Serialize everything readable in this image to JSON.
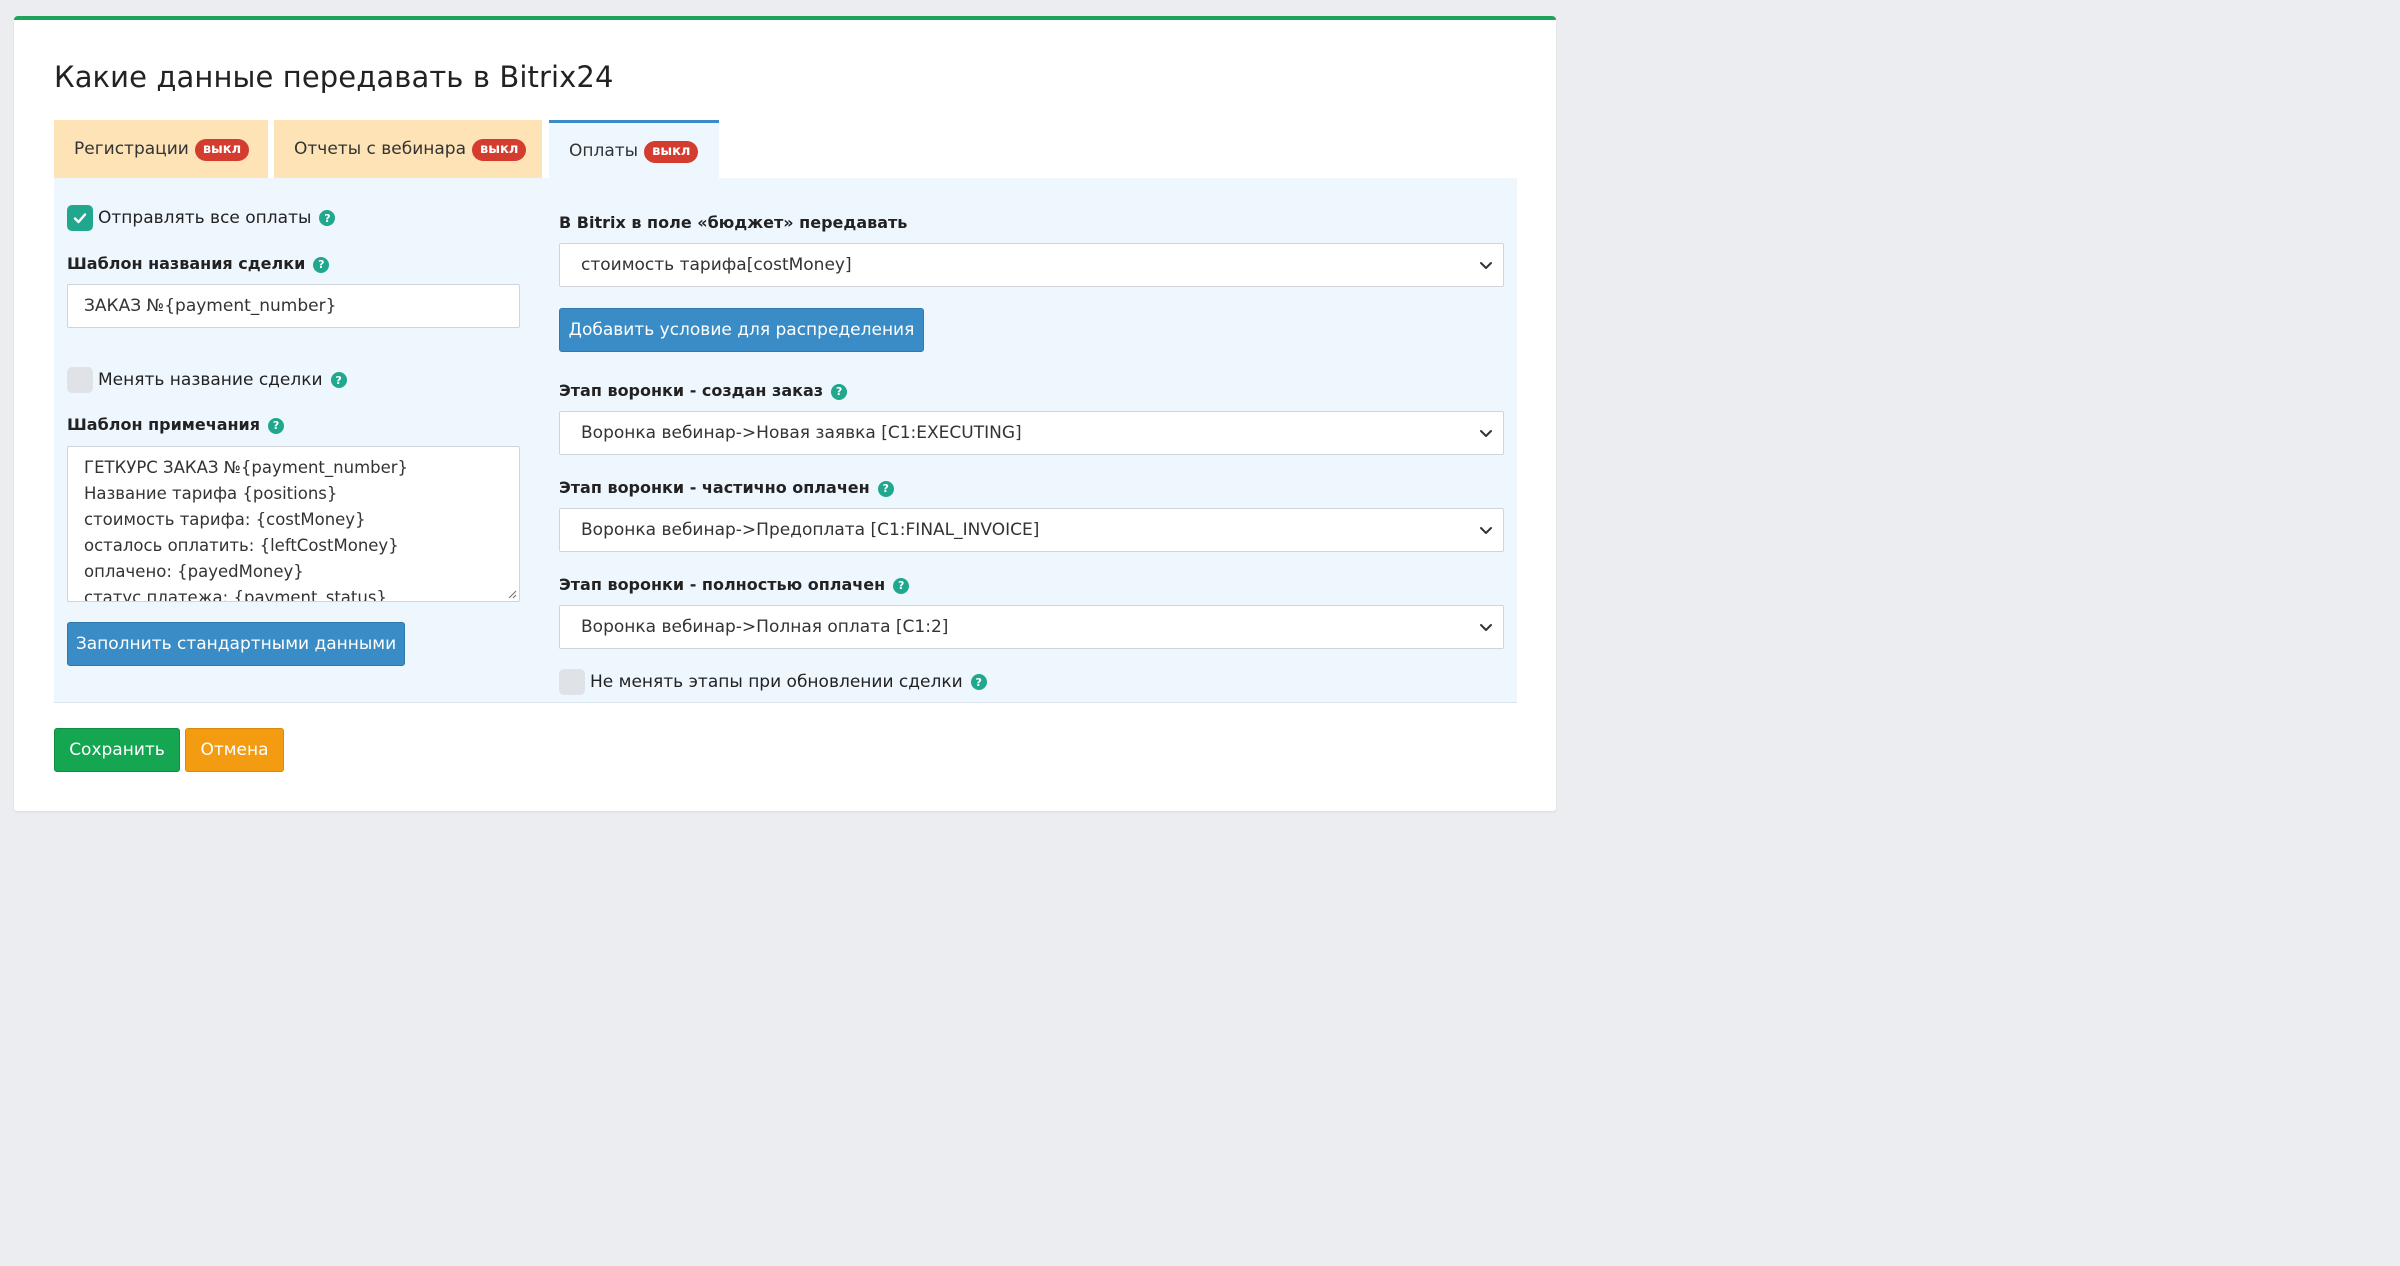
{
  "title": "Какие данные передавать в Bitrix24",
  "colors": {
    "accent_green": "#1ea35a",
    "tab_inactive": "#fde3b6",
    "badge_red": "#d33c2f",
    "primary_blue": "#3a8cc6"
  },
  "tabs": [
    {
      "label": "Регистрации",
      "badge": "выкл",
      "active": false
    },
    {
      "label": "Отчеты с вебинара",
      "badge": "выкл",
      "active": false
    },
    {
      "label": "Оплаты",
      "badge": "выкл",
      "active": true
    }
  ],
  "left": {
    "send_all": {
      "label": "Отправлять все оплаты",
      "checked": true
    },
    "deal_name_template": {
      "label": "Шаблон названия сделки",
      "value": "ЗАКАЗ №{payment_number}"
    },
    "change_deal_name": {
      "label": "Менять название сделки",
      "checked": false
    },
    "note_template": {
      "label": "Шаблон примечания",
      "lines": [
        "ГЕТКУРС ЗАКАЗ №{payment_number}",
        "Название тарифа {positions}",
        "стоимость тарифа: {costMoney}",
        "осталось оплатить: {leftCostMoney}",
        "оплачено: {payedMoney}",
        "статус платежа: {payment_status}"
      ]
    },
    "fill_default_button": "Заполнить стандартными данными"
  },
  "right": {
    "budget": {
      "label": "В Bitrix в поле «бюджет» передавать",
      "value": "стоимость тарифа[costMoney]"
    },
    "add_condition_button": "Добавить условие для распределения",
    "stage_created": {
      "label": "Этап воронки - создан заказ",
      "value": "Воронка вебинар->Новая заявка [C1:EXECUTING]"
    },
    "stage_partial": {
      "label": "Этап воронки - частично оплачен",
      "value": "Воронка вебинар->Предоплата [C1:FINAL_INVOICE]"
    },
    "stage_full": {
      "label": "Этап воронки - полностью оплачен",
      "value": "Воронка вебинар->Полная оплата [C1:2]"
    },
    "keep_stages": {
      "label": "Не менять этапы при обновлении сделки",
      "checked": false
    }
  },
  "footer": {
    "save": "Сохранить",
    "cancel": "Отмена"
  },
  "help_glyph": "?"
}
